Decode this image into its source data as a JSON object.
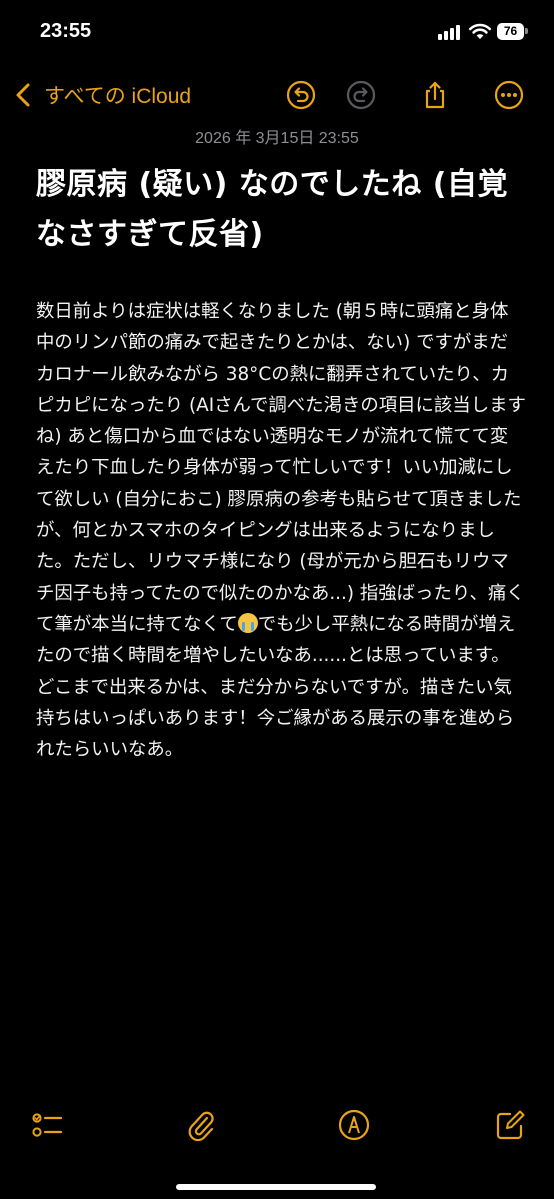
{
  "status_bar": {
    "time": "23:55",
    "battery": "76"
  },
  "nav": {
    "back_label": "すべての iCloud"
  },
  "note": {
    "date": "2026 年 3月15日 23:55",
    "title": "膠原病 (疑い) なのでしたね (自覚なさすぎて反省)",
    "body_part1": "数日前よりは症状は軽くなりました (朝５時に頭痛と身体中のリンパ節の痛みで起きたりとかは、ない) ですがまだカロナール飲みながら 38°Cの熱に翻弄されていたり、カピカピになったり (AIさんで調べた渇きの項目に該当しますね) あと傷口から血ではない透明なモノが流れて慌てて変えたり下血したり身体が弱って忙しいです！いい加減にして欲しい (自分におこ) 膠原病の参考も貼らせて頂きましたが、何とかスマホのタイピングは出来るようになりました。ただし、リウマチ様になり (母が元から胆石もリウマチ因子も持ってたので似たのかなあ...) 指強ばったり、痛くて筆が本当に持てなくて",
    "body_emoji": "loudly-crying-face",
    "body_part2": "でも少し平熱になる時間が増えたので描く時間を増やしたいなあ......とは思っています。どこまで出来るかは、まだ分からないですが。描きたい気持ちはいっぱいあります！今ご縁がある展示の事を進められたらいいなあ。"
  },
  "colors": {
    "accent": "#e8a317",
    "disabled": "#5a5a5e",
    "background": "#000000",
    "date": "#8e8e93"
  },
  "icons": {
    "nav": [
      "chevron-left-icon",
      "undo-icon",
      "redo-icon",
      "share-icon",
      "more-icon"
    ],
    "toolbar": [
      "checklist-icon",
      "paperclip-icon",
      "markup-pen-icon",
      "compose-icon"
    ]
  }
}
